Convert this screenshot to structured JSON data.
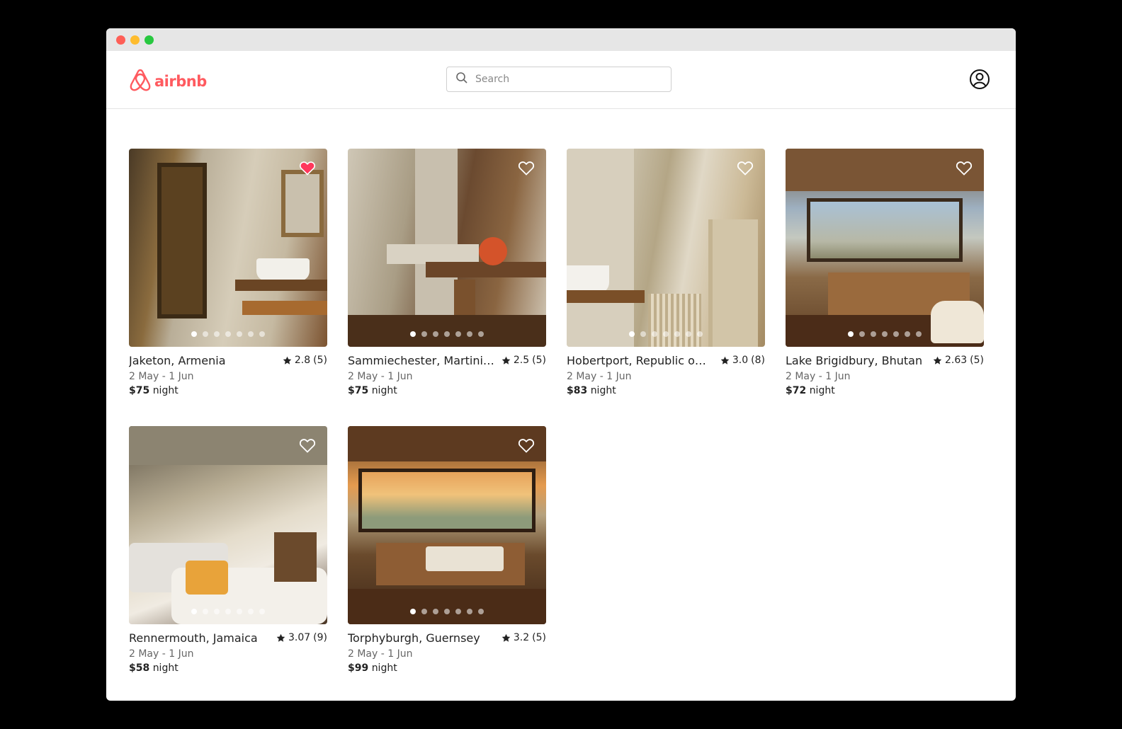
{
  "window": {
    "traffic_lights": [
      "close",
      "minimize",
      "maximize"
    ]
  },
  "header": {
    "logo_text": "airbnb",
    "brand_color": "#ff5a5f",
    "search_placeholder": "Search",
    "account_icon": "user-circle-icon"
  },
  "listings": [
    {
      "name": "Jaketon, Armenia",
      "rating": "2.8",
      "reviews": "(5)",
      "dates": "2 May - 1 Jun",
      "price": "$75",
      "unit": "night",
      "favorited": true,
      "photo_index": 0,
      "photo_count": 7
    },
    {
      "name": "Sammiechester, Martinique",
      "rating": "2.5",
      "reviews": "(5)",
      "dates": "2 May - 1 Jun",
      "price": "$75",
      "unit": "night",
      "favorited": false,
      "photo_index": 0,
      "photo_count": 7
    },
    {
      "name": "Hobertport, Republic of...",
      "rating": "3.0",
      "reviews": "(8)",
      "dates": "2 May - 1 Jun",
      "price": "$83",
      "unit": "night",
      "favorited": false,
      "photo_index": 0,
      "photo_count": 7
    },
    {
      "name": "Lake Brigidbury, Bhutan",
      "rating": "2.63",
      "reviews": "(5)",
      "dates": "2 May - 1 Jun",
      "price": "$72",
      "unit": "night",
      "favorited": false,
      "photo_index": 0,
      "photo_count": 7
    },
    {
      "name": "Rennermouth, Jamaica",
      "rating": "3.07",
      "reviews": "(9)",
      "dates": "2 May - 1 Jun",
      "price": "$58",
      "unit": "night",
      "favorited": false,
      "photo_index": 0,
      "photo_count": 7
    },
    {
      "name": "Torphyburgh, Guernsey",
      "rating": "3.2",
      "reviews": "(5)",
      "dates": "2 May - 1 Jun",
      "price": "$99",
      "unit": "night",
      "favorited": false,
      "photo_index": 0,
      "photo_count": 7
    }
  ]
}
